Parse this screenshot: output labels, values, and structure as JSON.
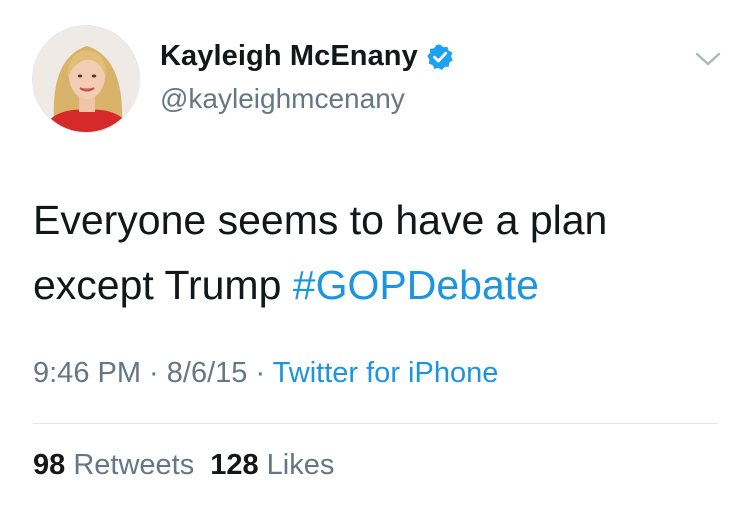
{
  "user": {
    "display_name": "Kayleigh McEnany",
    "handle": "@kayleighmcenany",
    "verified": true,
    "avatar_icon": "profile-photo"
  },
  "tweet": {
    "text": "Everyone seems to have a plan except Trump",
    "hashtag": "#GOPDebate"
  },
  "meta": {
    "time": "9:46 PM",
    "sep1": " · ",
    "date": "8/6/15",
    "sep2": " · ",
    "source": "Twitter for iPhone"
  },
  "stats": {
    "retweets_count": "98",
    "retweets_label": "Retweets",
    "likes_count": "128",
    "likes_label": "Likes"
  },
  "icons": {
    "verified": "verified-badge-icon",
    "menu": "chevron-down-icon"
  },
  "colors": {
    "link": "#1b95e0",
    "secondary_text": "#657786",
    "primary_text": "#14171a",
    "verified": "#1da1f2",
    "divider": "#e1e8ed"
  }
}
